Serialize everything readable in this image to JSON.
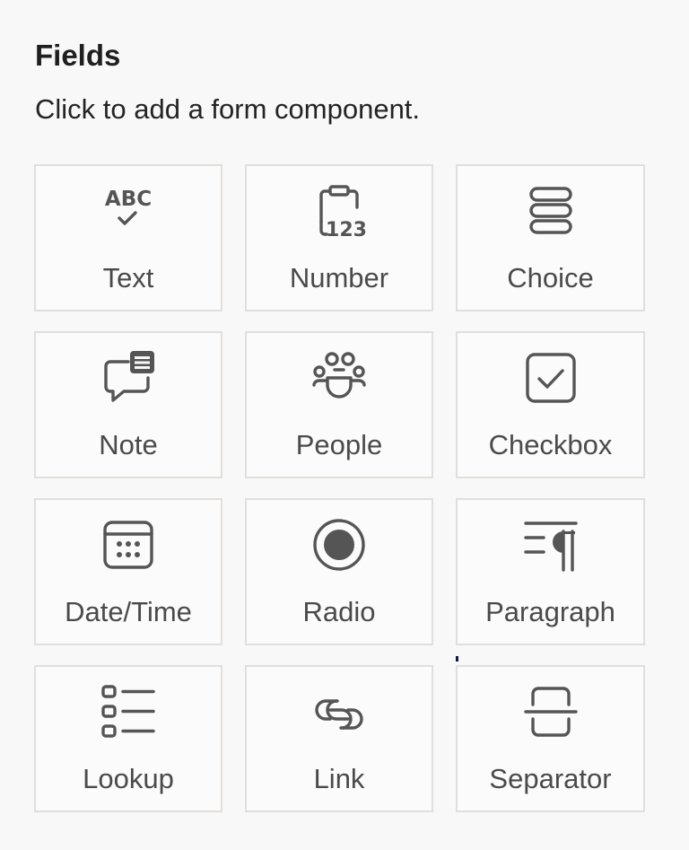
{
  "header": {
    "title": "Fields",
    "subtitle": "Click to add a form component."
  },
  "fields": [
    {
      "label": "Text",
      "icon": "text-abc-check-icon"
    },
    {
      "label": "Number",
      "icon": "number-123-icon"
    },
    {
      "label": "Choice",
      "icon": "choice-stack-icon"
    },
    {
      "label": "Note",
      "icon": "note-chat-icon"
    },
    {
      "label": "People",
      "icon": "people-group-icon"
    },
    {
      "label": "Checkbox",
      "icon": "checkbox-icon"
    },
    {
      "label": "Date/Time",
      "icon": "calendar-icon"
    },
    {
      "label": "Radio",
      "icon": "radio-button-icon"
    },
    {
      "label": "Paragraph",
      "icon": "paragraph-icon"
    },
    {
      "label": "Lookup",
      "icon": "lookup-list-icon"
    },
    {
      "label": "Link",
      "icon": "link-icon"
    },
    {
      "label": "Separator",
      "icon": "separator-icon"
    }
  ],
  "icon_text": {
    "abc": "ABC",
    "num": "123"
  },
  "colors": {
    "background": "#f8f8f8",
    "tile_border": "#e1dfdd",
    "icon": "#555555",
    "label": "#4a4a4a"
  }
}
